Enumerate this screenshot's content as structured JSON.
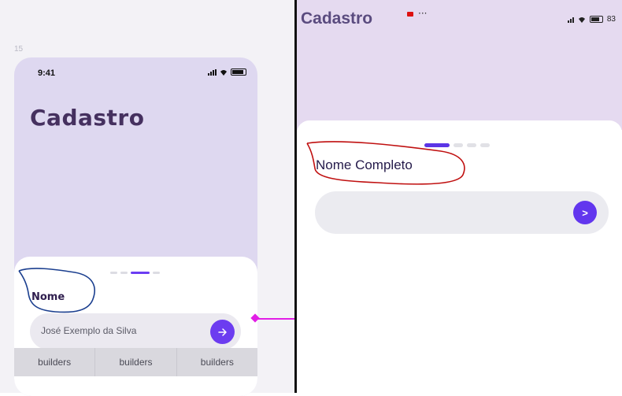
{
  "figma": {
    "frame_number": "15",
    "status_time": "9:41",
    "title": "Cadastro",
    "step_label": "Nome",
    "input_value": "José Exemplo da Silva",
    "submit_icon": "arrow-right",
    "footer_tabs": [
      "builders",
      "builders",
      "builders"
    ]
  },
  "device": {
    "title": "Cadastro",
    "more": "···",
    "battery": "83",
    "step_label": "Nome Completo",
    "input_value": "",
    "submit_label": ">"
  },
  "colors": {
    "accent": "#6c3cf0",
    "header_bg": "#ded8f0",
    "title": "#45305f",
    "annotation_blue": "#1b3f8f",
    "annotation_red": "#c01010",
    "connector": "#e21ee6"
  }
}
